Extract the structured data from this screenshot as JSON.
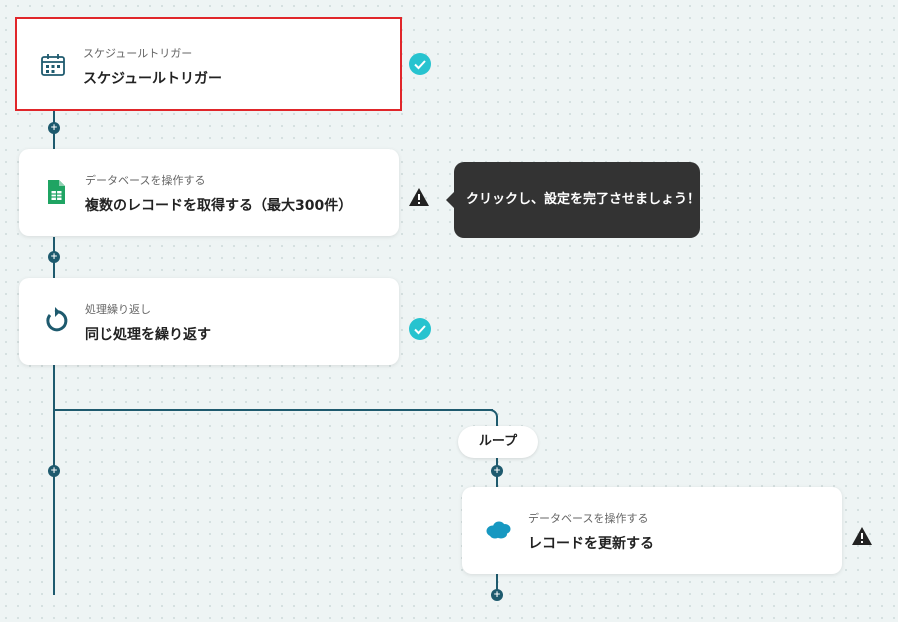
{
  "steps": [
    {
      "subtitle": "スケジュールトリガー",
      "title": "スケジュールトリガー",
      "icon": "calendar-icon",
      "status": "complete"
    },
    {
      "subtitle": "データベースを操作する",
      "title": "複数のレコードを取得する（最大300件）",
      "icon": "google-sheets-icon",
      "status": "warning"
    },
    {
      "subtitle": "処理繰り返し",
      "title": "同じ処理を繰り返す",
      "icon": "loop-icon",
      "status": "complete"
    },
    {
      "subtitle": "データベースを操作する",
      "title": "レコードを更新する",
      "icon": "salesforce-icon",
      "status": "warning"
    }
  ],
  "tooltip": {
    "text": "クリックし、設定を完了させましょう！"
  },
  "loop": {
    "label": "ループ"
  },
  "colors": {
    "line": "#1e5a6e",
    "check": "#27c3cf",
    "selected_border": "#e0262a",
    "tooltip_bg": "#333333"
  }
}
